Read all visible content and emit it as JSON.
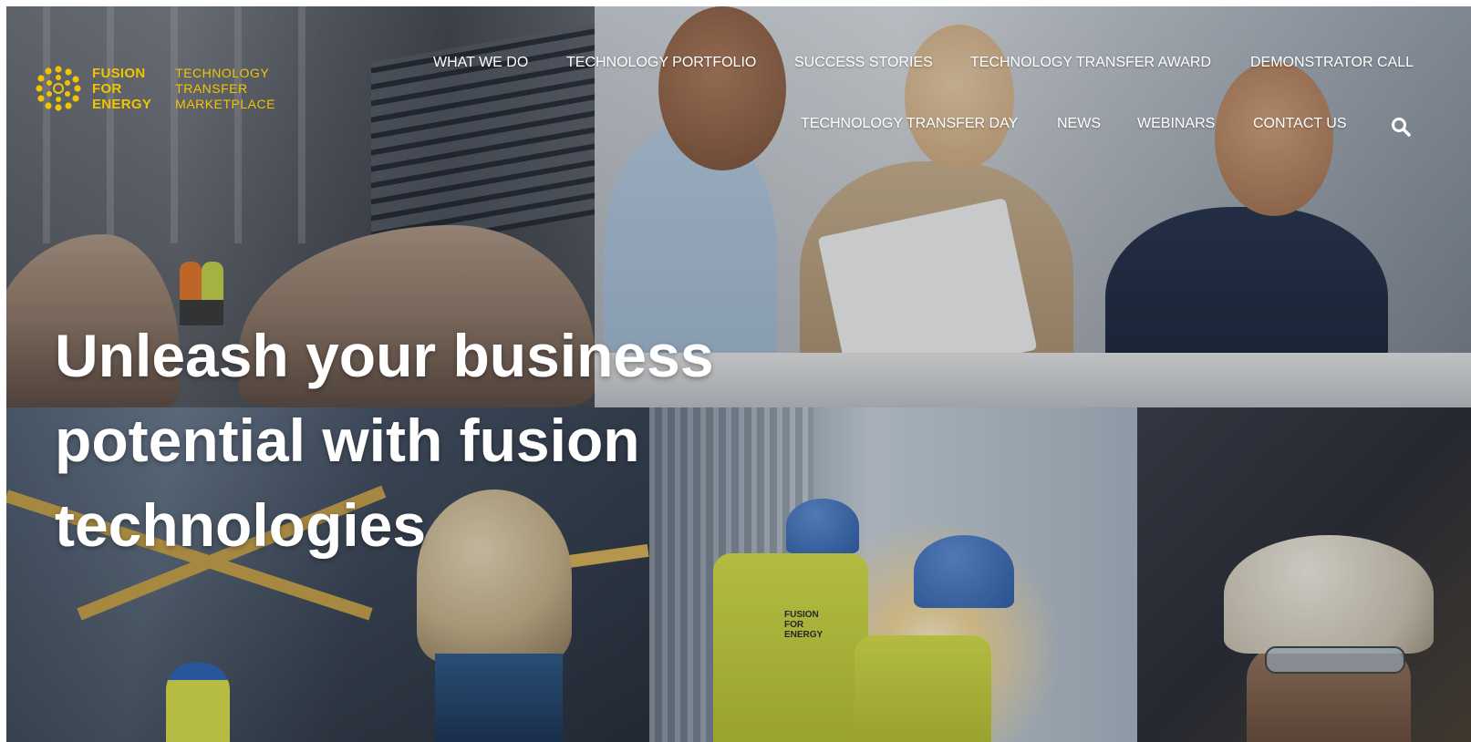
{
  "brand": {
    "logo_lines": [
      "FUSION",
      "FOR",
      "ENERGY"
    ],
    "tagline_lines": [
      "TECHNOLOGY",
      "TRANSFER",
      "MARKETPLACE"
    ],
    "color": "#f2c400"
  },
  "nav": {
    "row1": [
      "WHAT WE DO",
      "TECHNOLOGY PORTFOLIO",
      "SUCCESS STORIES",
      "TECHNOLOGY TRANSFER AWARD",
      "DEMONSTRATOR CALL"
    ],
    "row2": [
      "TECHNOLOGY TRANSFER DAY",
      "NEWS",
      "WEBINARS",
      "CONTACT US"
    ],
    "search_icon": "search-icon"
  },
  "hero": {
    "headline_lines": [
      "Unleash your business",
      "potential with fusion",
      "technologies"
    ]
  },
  "vests": {
    "text_lines": [
      "FUSION",
      "FOR",
      "ENERGY"
    ]
  }
}
